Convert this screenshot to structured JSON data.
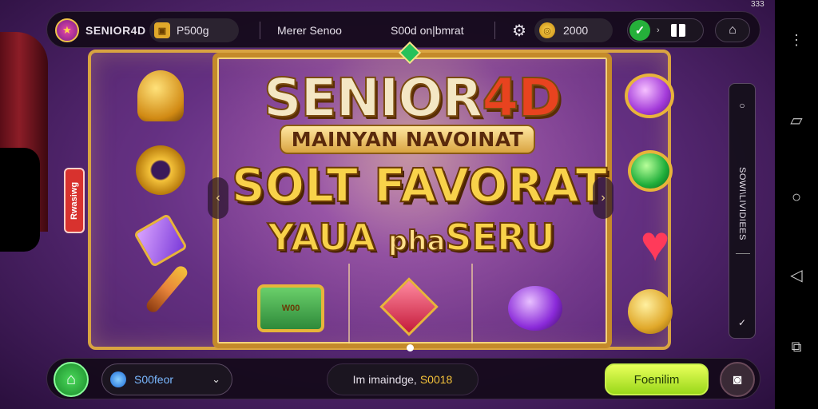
{
  "top_bar": {
    "logo_text": "SENIOR4D",
    "balance": "P500g",
    "link_one": "Merer Senoo",
    "link_two": "S00d on|bmrat",
    "coins": "2000",
    "status_mini": "333"
  },
  "banner": {
    "title_main": "SENIOR",
    "title_accent": "4D",
    "subtitle": "MAINYAN NAVOINAT",
    "headline": "SOLT FAVORAT",
    "tagline_left": "YAUA ",
    "tagline_mid": "pha",
    "tagline_right": "SERU",
    "chest_label": "W00"
  },
  "left_tag": "Rwasiwg",
  "side_panel": {
    "label": "SOWI\\LIVIDIEES"
  },
  "bottom_bar": {
    "select_value": "S00feor",
    "status_prefix": "Im imaindge, ",
    "status_amount": "S0018",
    "action_label": "Foenilim"
  },
  "icons": {
    "logo": "logo-icon",
    "gear": "gear-icon",
    "check": "check-icon",
    "pause": "pause-icon",
    "home": "home-icon",
    "camera": "camera-icon",
    "android_back": "triangle-back-icon",
    "android_home": "circle-home-icon",
    "android_recents": "square-recents-icon"
  },
  "colors": {
    "accent_gold": "#d9a441",
    "title_red": "#e8431f",
    "action_green": "#9ad81a",
    "check_green": "#25b03a"
  }
}
